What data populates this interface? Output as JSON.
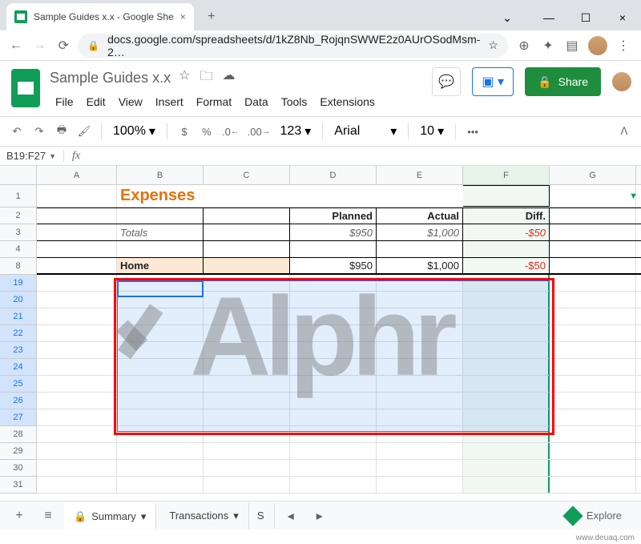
{
  "browser": {
    "tab_title": "Sample Guides x.x - Google She",
    "url": "docs.google.com/spreadsheets/d/1kZ8Nb_RojqnSWWE2z0AUrOSodMsm-2…"
  },
  "doc": {
    "title": "Sample Guides x.x",
    "menus": [
      "File",
      "Edit",
      "View",
      "Insert",
      "Format",
      "Data",
      "Tools",
      "Extensions"
    ]
  },
  "share": {
    "label": "Share"
  },
  "toolbar": {
    "zoom": "100%",
    "currency": "$",
    "percent": "%",
    "dec_dec": ".0",
    "inc_dec": ".00",
    "format": "123",
    "font": "Arial",
    "font_size": "10",
    "more": "•••"
  },
  "name_box": "B19:F27",
  "columns": [
    "A",
    "B",
    "C",
    "D",
    "E",
    "F",
    "G"
  ],
  "rows_visible": [
    "1",
    "2",
    "3",
    "4",
    "8",
    "19",
    "20",
    "21",
    "22",
    "23",
    "24",
    "25",
    "26",
    "27",
    "28",
    "29",
    "30",
    "31"
  ],
  "sheet": {
    "title": "Expenses",
    "headers": {
      "planned": "Planned",
      "actual": "Actual",
      "diff": "Diff."
    },
    "totals_row": {
      "label": "Totals",
      "planned": "$950",
      "actual": "$1,000",
      "diff": "-$50"
    },
    "home_row": {
      "label": "Home",
      "planned": "$950",
      "actual": "$1,000",
      "diff": "-$50"
    }
  },
  "tabs": {
    "summary": "Summary",
    "transactions": "Transactions",
    "other": "S",
    "explore": "Explore"
  },
  "footer": "www.deuaq.com"
}
